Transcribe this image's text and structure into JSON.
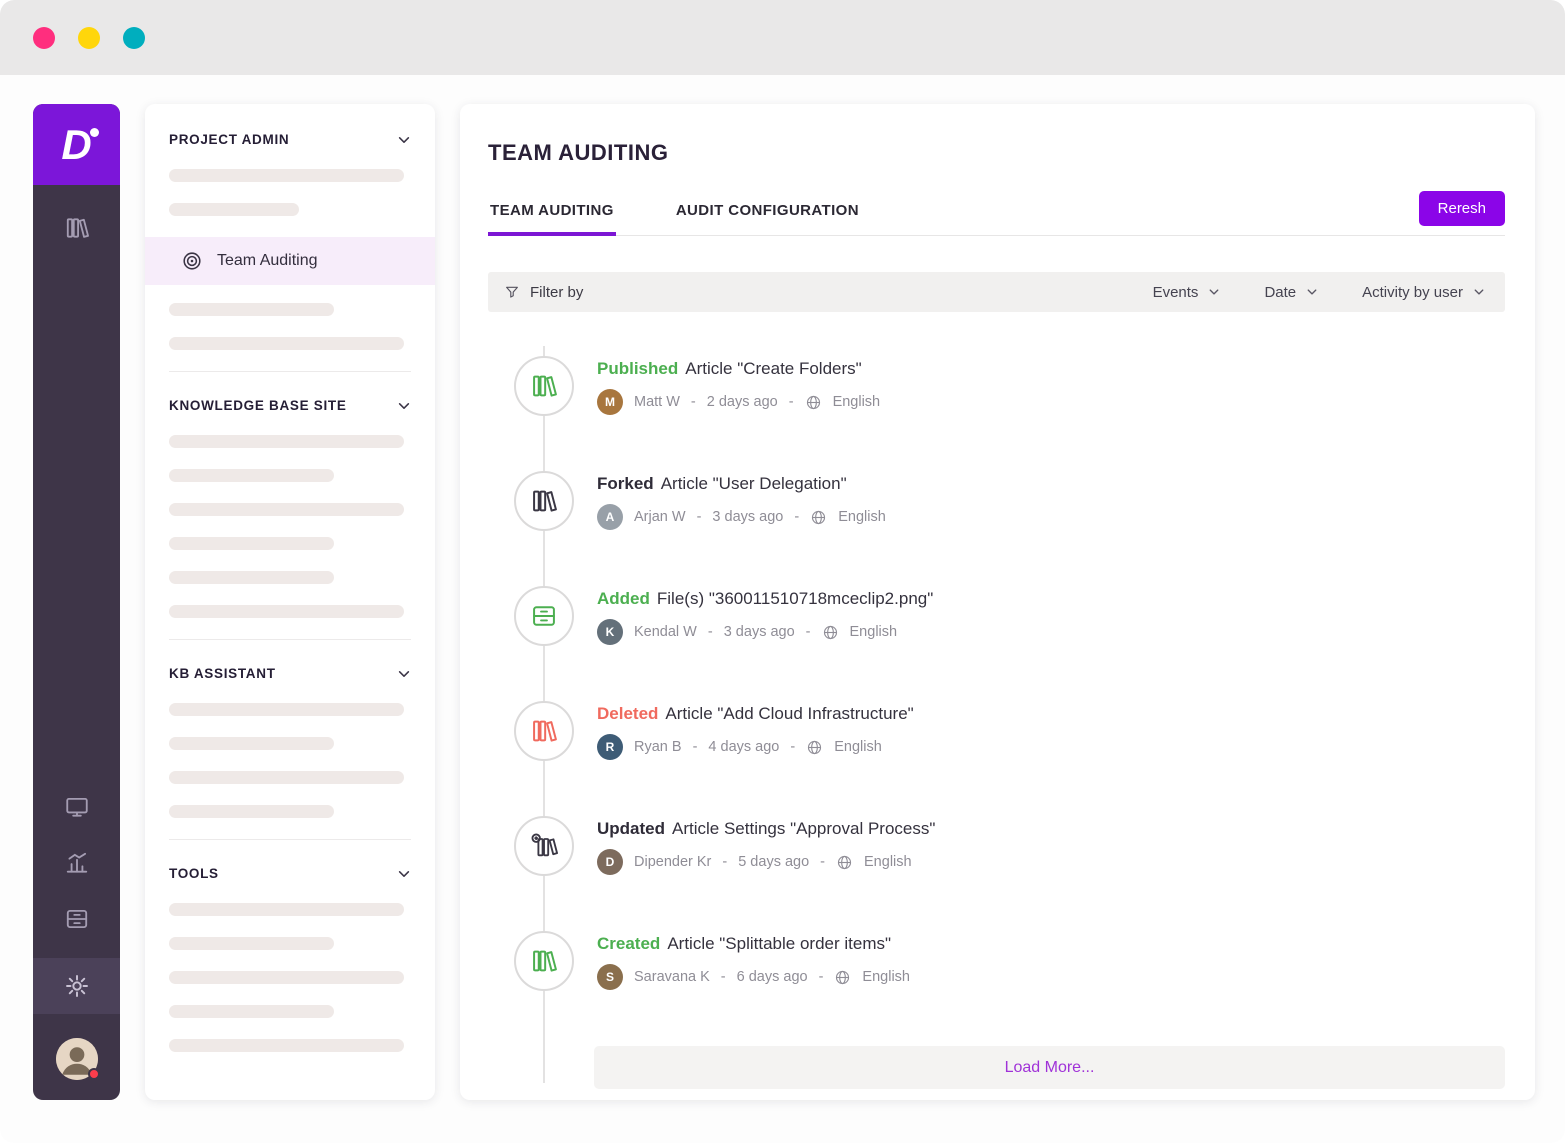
{
  "colors": {
    "accent_purple": "#8b05e8",
    "logo_purple": "#7c16d9",
    "sidebar_dark": "#3e3548",
    "green": "#4caf50",
    "red": "#f06a5e",
    "dot_close": "#ff2e7e",
    "dot_min": "#ffd60b",
    "dot_max": "#00aebe"
  },
  "nav": {
    "sections": [
      {
        "label": "PROJECT ADMIN"
      },
      {
        "label": "KNOWLEDGE BASE SITE"
      },
      {
        "label": "KB ASSISTANT"
      },
      {
        "label": "TOOLS"
      }
    ],
    "active_item": {
      "label": "Team Auditing"
    }
  },
  "main": {
    "title": "TEAM AUDITING",
    "tabs": [
      {
        "label": "TEAM AUDITING",
        "active": true
      },
      {
        "label": "AUDIT CONFIGURATION",
        "active": false
      }
    ],
    "refresh_label": "Reresh",
    "filter": {
      "label": "Filter by",
      "dropdowns": [
        "Events",
        "Date",
        "Activity by user"
      ]
    },
    "meta_separator": "-",
    "events": [
      {
        "icon": "books-icon",
        "color": "green",
        "action": "Published",
        "text": "Article \"Create Folders\"",
        "user": "Matt W",
        "time": "2 days ago",
        "language": "English"
      },
      {
        "icon": "books-icon",
        "color": "dark",
        "action": "Forked",
        "text": "Article \"User Delegation\"",
        "user": "Arjan W",
        "time": "3 days ago",
        "language": "English"
      },
      {
        "icon": "drawer-icon",
        "color": "green",
        "action": "Added",
        "text": "File(s) \"360011510718mceclip2.png\"",
        "user": "Kendal W",
        "time": "3 days ago",
        "language": "English"
      },
      {
        "icon": "books-icon",
        "color": "red",
        "action": "Deleted",
        "text": "Article \"Add Cloud Infrastructure\"",
        "user": "Ryan B",
        "time": "4 days ago",
        "language": "English"
      },
      {
        "icon": "books-gear-icon",
        "color": "dark",
        "action": "Updated",
        "text": "Article Settings \"Approval Process\"",
        "user": "Dipender Kr",
        "time": "5 days ago",
        "language": "English"
      },
      {
        "icon": "books-icon",
        "color": "green",
        "action": "Created",
        "text": "Article \"Splittable order items\"",
        "user": "Saravana K",
        "time": "6 days ago",
        "language": "English"
      }
    ],
    "load_more_label": "Load More..."
  }
}
